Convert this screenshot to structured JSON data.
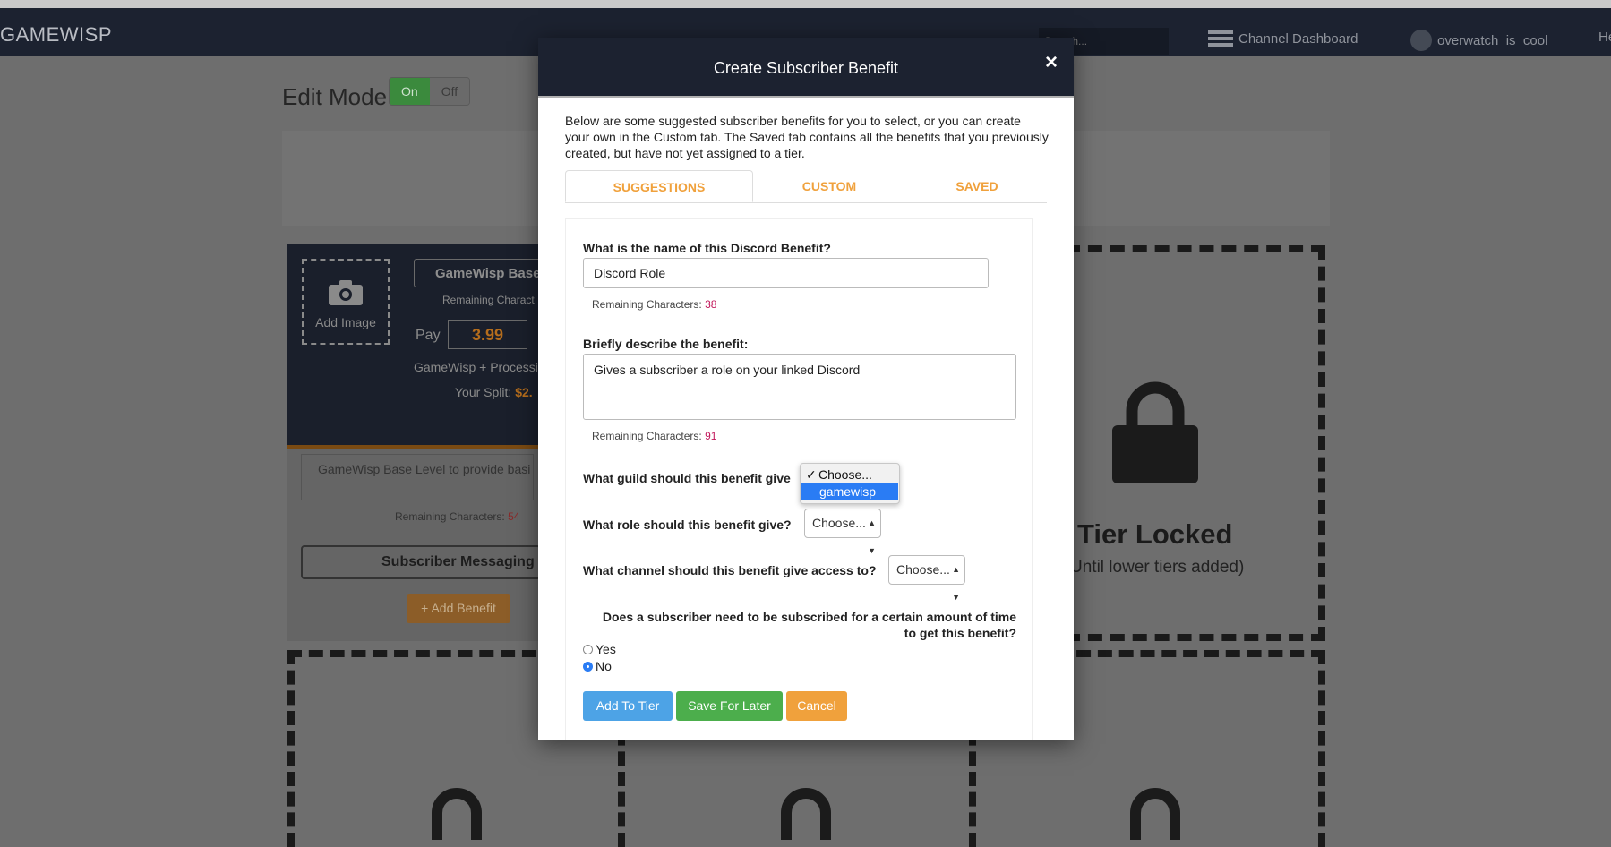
{
  "nav": {
    "brand": "GAMEWISP",
    "search_placeholder": "Search...",
    "dashboard_label": "Channel Dashboard",
    "username": "overwatch_is_cool",
    "help_label": "He"
  },
  "page": {
    "edit_mode_label": "Edit Mode",
    "toggle_on": "On",
    "toggle_off": "Off"
  },
  "tier": {
    "add_image_label": "Add Image",
    "name": "GameWisp Base",
    "remaining_label": "Remaining Charact",
    "pay_label": "Pay",
    "price": "3.99",
    "processing_label": "GameWisp + Processi",
    "your_split_label": "Your Split:",
    "your_split_value": "$2.",
    "description": "GameWisp Base Level to provide basi",
    "desc_remaining_label": "Remaining Characters:",
    "desc_remaining_value": "54",
    "subscriber_messaging": "Subscriber Messaging",
    "add_benefit": "+ Add Benefit"
  },
  "locked_tier": {
    "title": "Tier Locked",
    "subtitle": "Until lower tiers added)"
  },
  "modal": {
    "title": "Create Subscriber Benefit",
    "close": "×",
    "intro": "Below are some suggested subscriber benefits for you to select, or you can create your own in the Custom tab. The Saved tab contains all the benefits that you previously created, but have not yet assigned to a tier.",
    "tabs": [
      "SUGGESTIONS",
      "CUSTOM",
      "SAVED"
    ],
    "name_question": "What is the name of this Discord Benefit?",
    "name_value": "Discord Role",
    "name_remaining_label": "Remaining Characters:",
    "name_remaining_value": "38",
    "describe_question": "Briefly describe the benefit:",
    "describe_value": "Gives a subscriber a role on your linked Discord",
    "describe_remaining_label": "Remaining Characters:",
    "describe_remaining_value": "91",
    "guild_question": "What guild should this benefit give",
    "guild_options": [
      "Choose...",
      "gamewisp"
    ],
    "role_question": "What role should this benefit give?",
    "role_select": "Choose...",
    "channel_question": "What channel should this benefit give access to?",
    "channel_select": "Choose...",
    "duration_question_line1": "Does a subscriber need to be subscribed for a certain amount of time",
    "duration_question_line2": "to get this benefit?",
    "radio_yes": "Yes",
    "radio_no": "No",
    "radio_selected": "No",
    "add_to_tier": "Add To Tier",
    "save_for_later": "Save For Later",
    "cancel": "Cancel",
    "colors": {
      "primary": "#4da3e6",
      "success": "#4cae4c",
      "warning": "#f0a13c",
      "header": "#1c2230"
    }
  }
}
